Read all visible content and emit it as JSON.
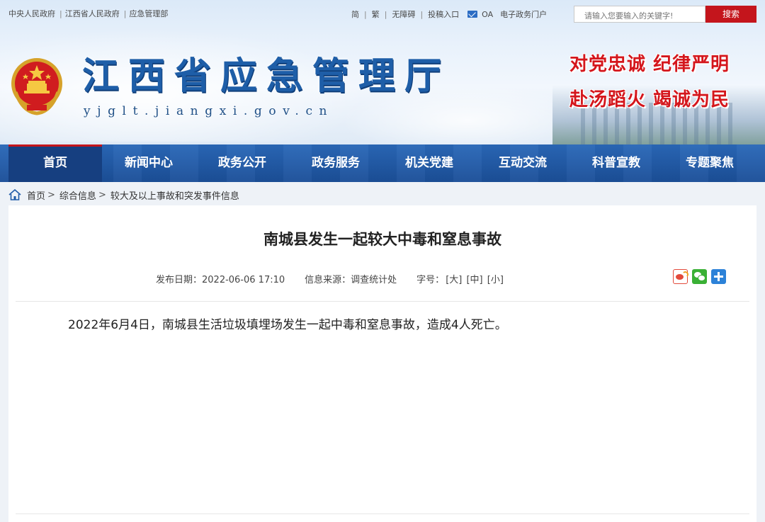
{
  "topbar": {
    "links": [
      "中央人民政府",
      "江西省人民政府",
      "应急管理部"
    ],
    "tools": [
      "简",
      "繁",
      "无障碍",
      "投稿入口"
    ],
    "oa_label": "OA",
    "portal_label": "电子政务门户",
    "search_placeholder": "请输入您要输入的关键字!",
    "search_button": "搜索"
  },
  "site": {
    "title": "江西省应急管理厅",
    "url": "yjglt.jiangxi.gov.cn",
    "slogan_1": "对党忠诚 纪律严明",
    "slogan_2": "赴汤蹈火 竭诚为民"
  },
  "nav": {
    "items": [
      "首页",
      "新闻中心",
      "政务公开",
      "政务服务",
      "机关党建",
      "互动交流",
      "科普宣教",
      "专题聚焦"
    ],
    "active_index": 0
  },
  "breadcrumb": {
    "items": [
      "首页",
      "综合信息",
      "较大及以上事故和突发事件信息"
    ],
    "separator": ">"
  },
  "article": {
    "title": "南城县发生一起较大中毒和窒息事故",
    "publish_date": "发布日期：2022-06-06 17:10",
    "source": "信息来源：调查统计处",
    "font_size_label": "字号：",
    "font_sizes": [
      "[大]",
      "[中]",
      "[小]"
    ],
    "body": "2022年6月4日，南城县生活垃圾填埋场发生一起中毒和窒息事故，造成4人死亡。"
  },
  "share_icons": [
    "weibo-icon",
    "wechat-icon",
    "plus-icon"
  ],
  "colors": {
    "nav_bg": "#1f5aa8",
    "accent_red": "#c4151c",
    "title_blue": "#1e5ea8"
  }
}
